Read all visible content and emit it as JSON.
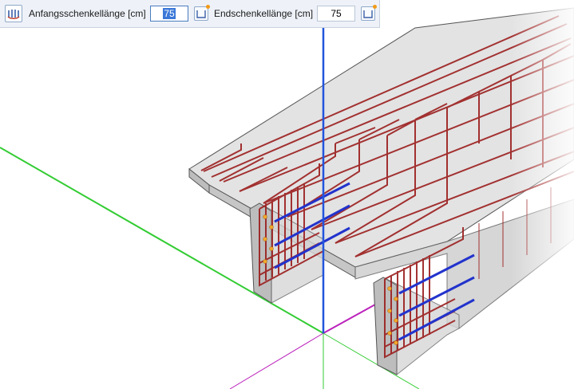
{
  "toolbar": {
    "tool_icon": "rebar-stirrups-icon",
    "start_leg_label": "Anfangsschenkellänge [cm]",
    "start_leg_value": "75",
    "end_leg_label": "Endschenkellänge [cm]",
    "end_leg_value": "75",
    "pick_icon": "pick-value-icon"
  },
  "colors": {
    "axis_x": "#33cc33",
    "axis_z": "#2255dd",
    "axis_y": "#bb22bb",
    "rebar": "#9b1d1d",
    "concrete_top": "#dddddd",
    "concrete_side": "#bcbcbc",
    "selected_bars": "#2233cc",
    "toolbar_bg": "#eef2f8"
  }
}
